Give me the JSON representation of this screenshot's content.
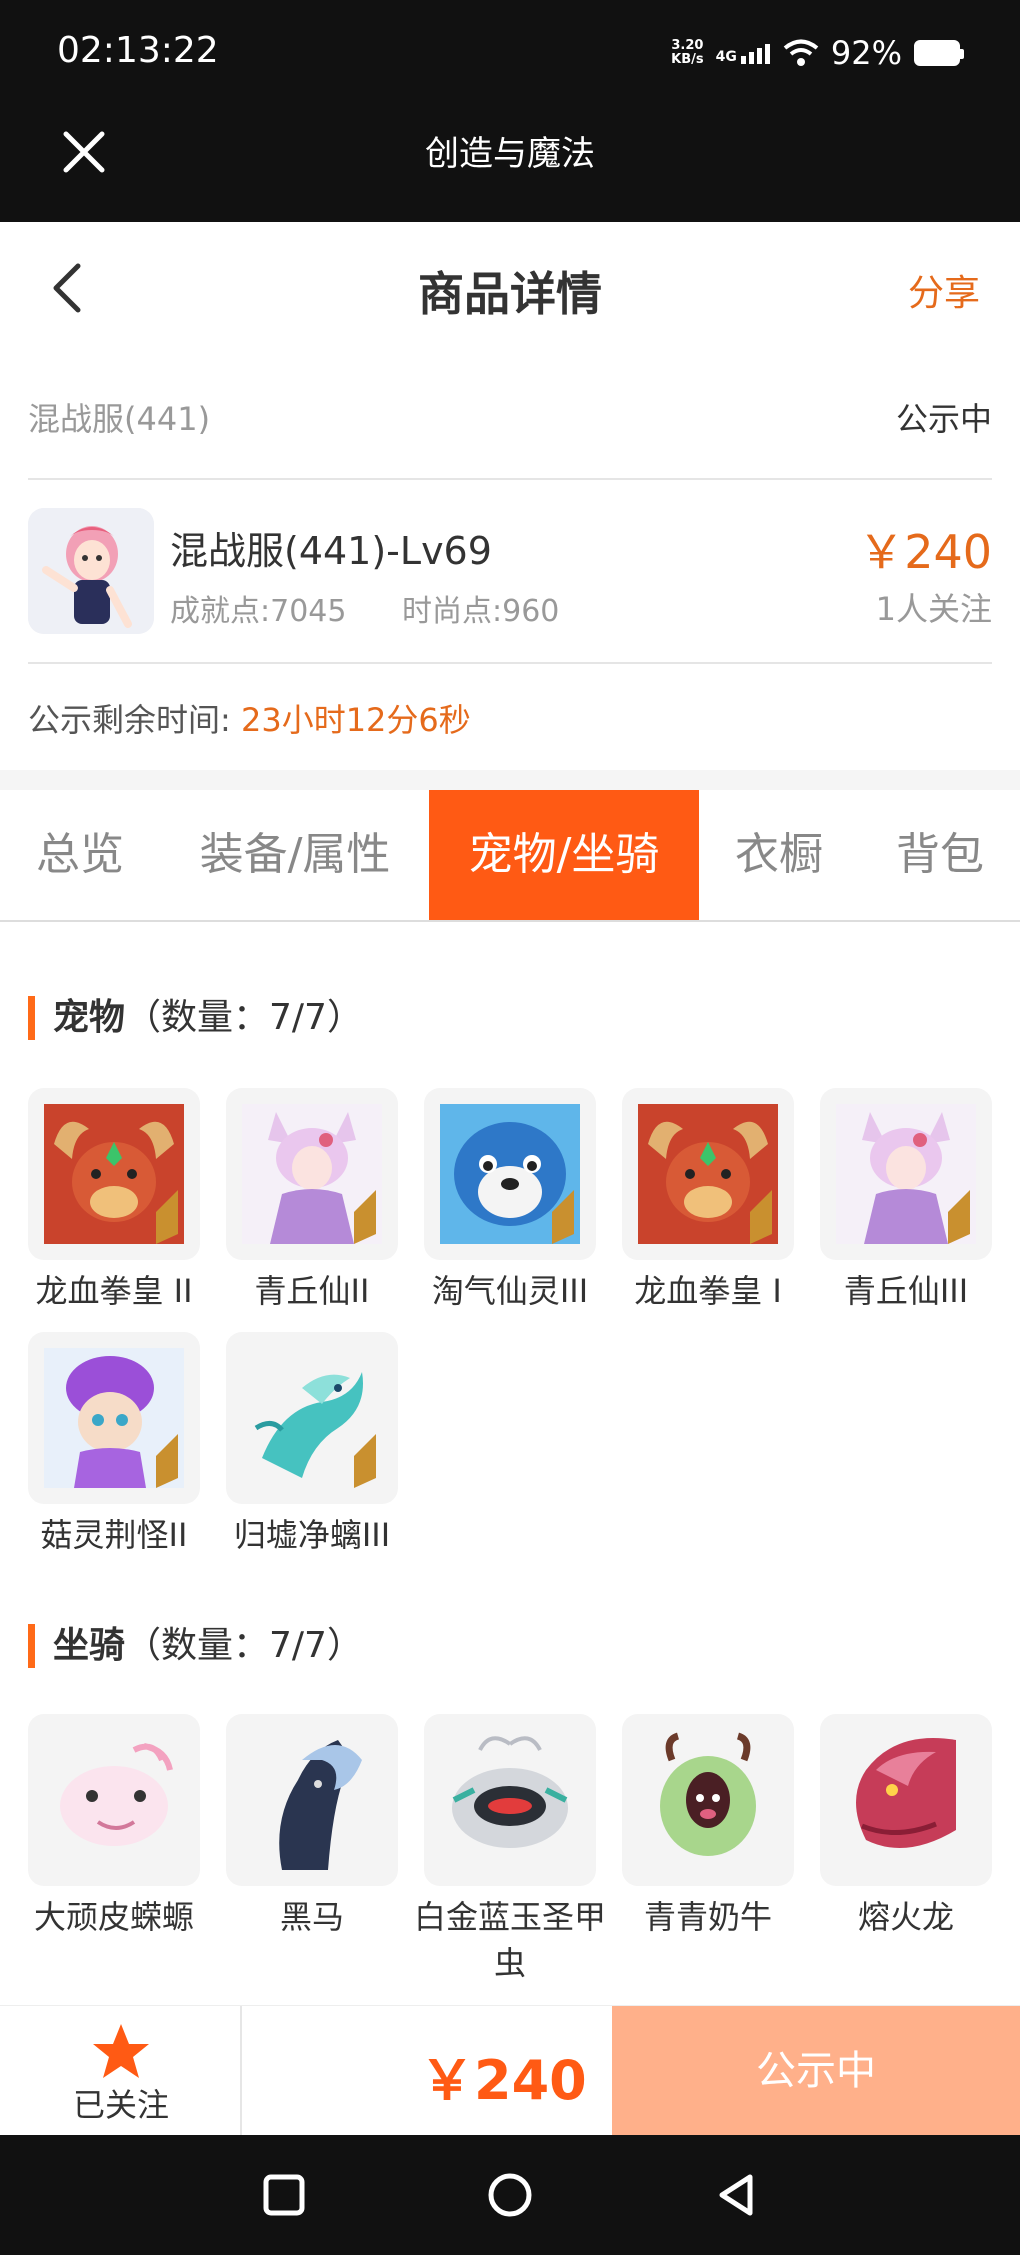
{
  "status_bar": {
    "time": "02:13:22",
    "net_speed_top": "3.20",
    "net_speed_unit": "KB/s",
    "network": "4G",
    "battery": "92%",
    "icons": [
      "signal-icon",
      "wifi-icon",
      "battery-icon"
    ]
  },
  "app_bar": {
    "title": "创造与魔法",
    "close_icon": "close-icon"
  },
  "header": {
    "title": "商品详情",
    "share": "分享",
    "back_icon": "back-icon"
  },
  "server": {
    "name": "混战服(441)",
    "status": "公示中"
  },
  "product": {
    "name": "混战服(441)-Lv69",
    "achievement": "成就点:7045",
    "fashion": "时尚点:960",
    "price": "￥240",
    "followers": "1人关注"
  },
  "remaining": {
    "label": "公示剩余时间:",
    "value": "23小时12分6秒"
  },
  "tabs": [
    {
      "label": "总览",
      "active": false
    },
    {
      "label": "装备/属性",
      "active": false
    },
    {
      "label": "宠物/坐骑",
      "active": true
    },
    {
      "label": "衣橱",
      "active": false
    },
    {
      "label": "背包",
      "active": false
    }
  ],
  "pets": {
    "title": "宠物",
    "count": "（数量：7/7）",
    "items": [
      {
        "label": "龙血拳皇 II",
        "icon": "dragon-fist-pet-icon",
        "rank": "II"
      },
      {
        "label": "青丘仙II",
        "icon": "fox-fairy-pet-icon",
        "rank": "II"
      },
      {
        "label": "淘气仙灵III",
        "icon": "blue-dog-pet-icon",
        "rank": "III"
      },
      {
        "label": "龙血拳皇 I",
        "icon": "dragon-fist-pet-icon",
        "rank": "I"
      },
      {
        "label": "青丘仙III",
        "icon": "fox-fairy-pet-icon",
        "rank": "III"
      },
      {
        "label": "菇灵荆怪II",
        "icon": "mushroom-sprite-pet-icon",
        "rank": "II"
      },
      {
        "label": "归墟净螭III",
        "icon": "sea-dragon-pet-icon",
        "rank": "III"
      }
    ]
  },
  "mounts": {
    "title": "坐骑",
    "count": "（数量：7/7）",
    "items": [
      {
        "label": "大顽皮蝾螈",
        "icon": "axolotl-mount-icon"
      },
      {
        "label": "黑马",
        "icon": "black-horse-mount-icon"
      },
      {
        "label": "白金蓝玉圣甲虫",
        "icon": "scarab-mount-icon"
      },
      {
        "label": "青青奶牛",
        "icon": "green-cow-mount-icon"
      },
      {
        "label": "熔火龙",
        "icon": "magma-dragon-mount-icon"
      }
    ]
  },
  "action_bar": {
    "follow_label": "已关注",
    "price": "￥240",
    "button": "公示中",
    "colors": {
      "accent": "#ff5a14",
      "button": "#ffb08a"
    }
  }
}
